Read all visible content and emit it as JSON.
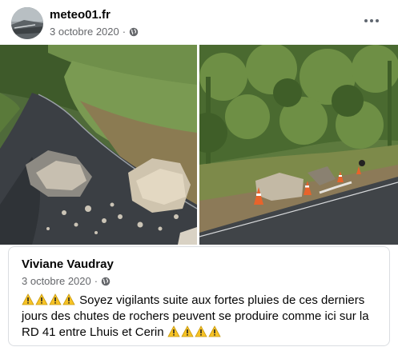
{
  "page": {
    "name": "meteo01.fr",
    "date": "3 octobre 2020",
    "separator": "·",
    "privacy_icon": "globe-icon",
    "more_icon": "more-options-icon"
  },
  "photos": [
    {
      "icon": "photo-fallen-rocks-road"
    },
    {
      "icon": "photo-road-cones-rocks"
    }
  ],
  "shared_post": {
    "author": "Viviane Vaudray",
    "date": "3 octobre 2020",
    "separator": "·",
    "privacy_icon": "globe-icon",
    "text": "Soyez vigilants suite aux fortes pluies de ces derniers jours des chutes de rochers peuvent se produire comme ici sur la RD 41 entre Lhuis et Cerin",
    "emoji_icon": "warning-emoji-icon"
  },
  "colors": {
    "secondary_text": "#65676b",
    "border": "#dadde1",
    "warning": "#f7c325"
  }
}
